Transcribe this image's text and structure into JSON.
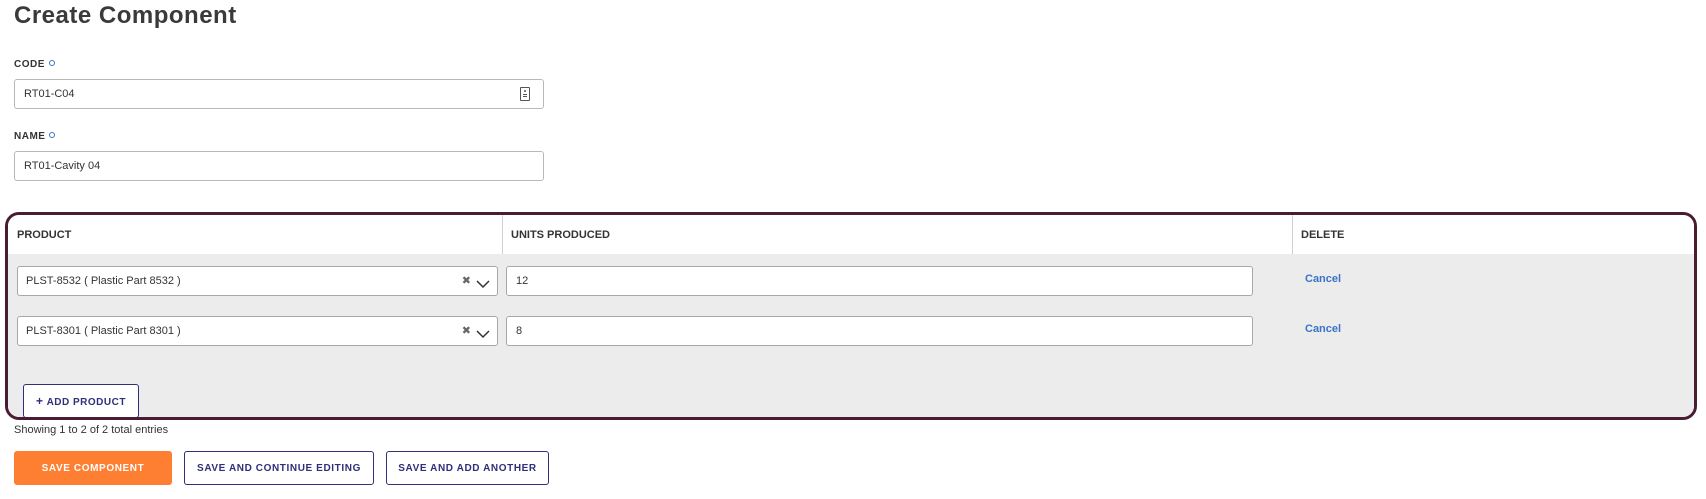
{
  "page": {
    "title": "Create Component"
  },
  "form": {
    "code": {
      "label": "CODE",
      "value": "RT01-C04"
    },
    "name": {
      "label": "NAME",
      "value": "RT01-Cavity 04"
    }
  },
  "products_grid": {
    "columns": [
      "PRODUCT",
      "UNITS PRODUCED",
      "DELETE"
    ],
    "rows": [
      {
        "product": "PLST-8532 ( Plastic Part 8532 )",
        "units": "12",
        "delete_label": "Cancel"
      },
      {
        "product": "PLST-8301 ( Plastic Part 8301 )",
        "units": "8",
        "delete_label": "Cancel"
      }
    ],
    "add_button": {
      "icon": "+",
      "label": "ADD PRODUCT"
    },
    "footer": "Showing 1 to 2 of 2 total entries"
  },
  "actions": {
    "save": "SAVE COMPONENT",
    "save_continue": "SAVE AND CONTINUE EDITING",
    "save_add": "SAVE AND ADD ANOTHER"
  },
  "colors": {
    "primary": "#ff7f32",
    "outline": "#2f2f7a",
    "link": "#3b73c8",
    "frame": "#4a1c32"
  }
}
